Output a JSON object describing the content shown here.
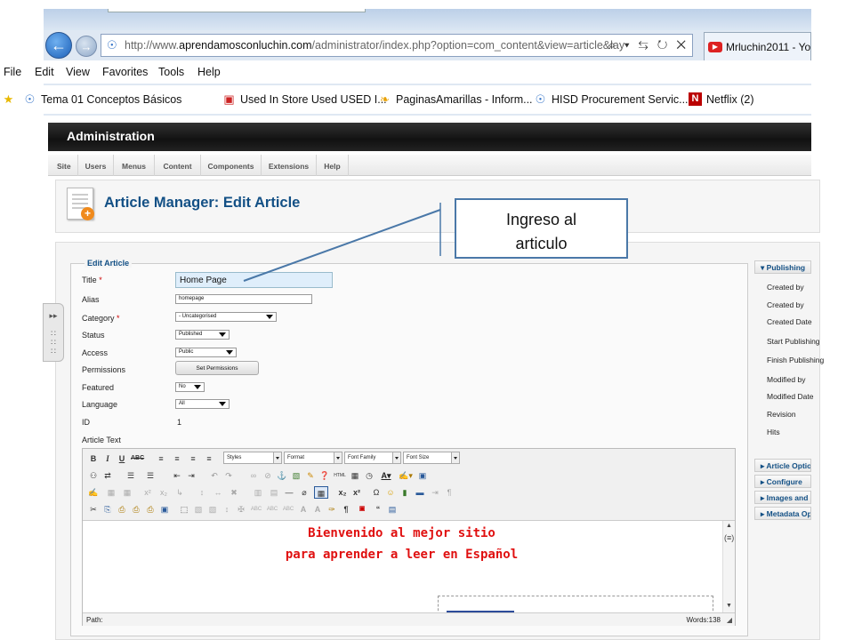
{
  "browser": {
    "url_prefix": "http://www.",
    "url_domain": "aprendamosconluchin.com",
    "url_path": "/administrator/index.php?option=com_content&view=article&lay",
    "address_icons": "⌕ ▾ ⇆ ↻ ✕",
    "tab_title": "Mrluchin2011 - Yo",
    "menu": [
      "File",
      "Edit",
      "View",
      "Favorites",
      "Tools",
      "Help"
    ],
    "favorites": [
      {
        "label": "Tema 01 Conceptos Básicos",
        "icon": "ie-page-icon"
      },
      {
        "label": "Used In Store Used USED I...",
        "icon": "store-icon"
      },
      {
        "label": "PaginasAmarillas - Inform...",
        "icon": "yellowpages-icon"
      },
      {
        "label": "HISD  Procurement Servic...",
        "icon": "ie-page-icon"
      },
      {
        "label": "Netflix (2)",
        "icon": "netflix-icon"
      }
    ]
  },
  "admin": {
    "header": "Administration",
    "menu": [
      "Site",
      "Users",
      "Menus",
      "Content",
      "Components",
      "Extensions",
      "Help"
    ],
    "page_title": "Article Manager: Edit Article"
  },
  "form": {
    "legend": "Edit Article",
    "fields": {
      "title": {
        "label": "Title",
        "value": "Home Page"
      },
      "alias": {
        "label": "Alias",
        "value": "homepage"
      },
      "category": {
        "label": "Category",
        "value": "- Uncategorised"
      },
      "status": {
        "label": "Status",
        "value": "Published"
      },
      "access": {
        "label": "Access",
        "value": "Public"
      },
      "permissions": {
        "label": "Permissions",
        "button": "Set Permissions"
      },
      "featured": {
        "label": "Featured",
        "value": "No"
      },
      "language": {
        "label": "Language",
        "value": "All"
      },
      "id": {
        "label": "ID",
        "value": "1"
      },
      "article_text": {
        "label": "Article Text"
      }
    },
    "required_mark": "*"
  },
  "editor": {
    "selects": [
      "Styles",
      "Format",
      "Font Family",
      "Font Size"
    ],
    "content_lines": [
      "Bienvenido al mejor sitio",
      "para aprender a leer en Español"
    ],
    "path_label": "Path:",
    "word_count": "Words:138"
  },
  "side_panel": {
    "publishing_header": "Publishing",
    "fields": [
      "Created by",
      "Created by",
      "Created Date",
      "Start Publishing",
      "Finish Publishing",
      "Modified by",
      "Modified Date",
      "Revision",
      "Hits"
    ],
    "collapsed_sections": [
      "Article Options",
      "Configure",
      "Images and Links",
      "Metadata Options"
    ]
  },
  "callout": {
    "line1": "Ingreso al",
    "line2": "articulo"
  },
  "colors": {
    "title_blue": "#135085",
    "editor_red": "#e01010",
    "admin_header": "#1a1a1a",
    "callout_border": "#4a78a8"
  }
}
